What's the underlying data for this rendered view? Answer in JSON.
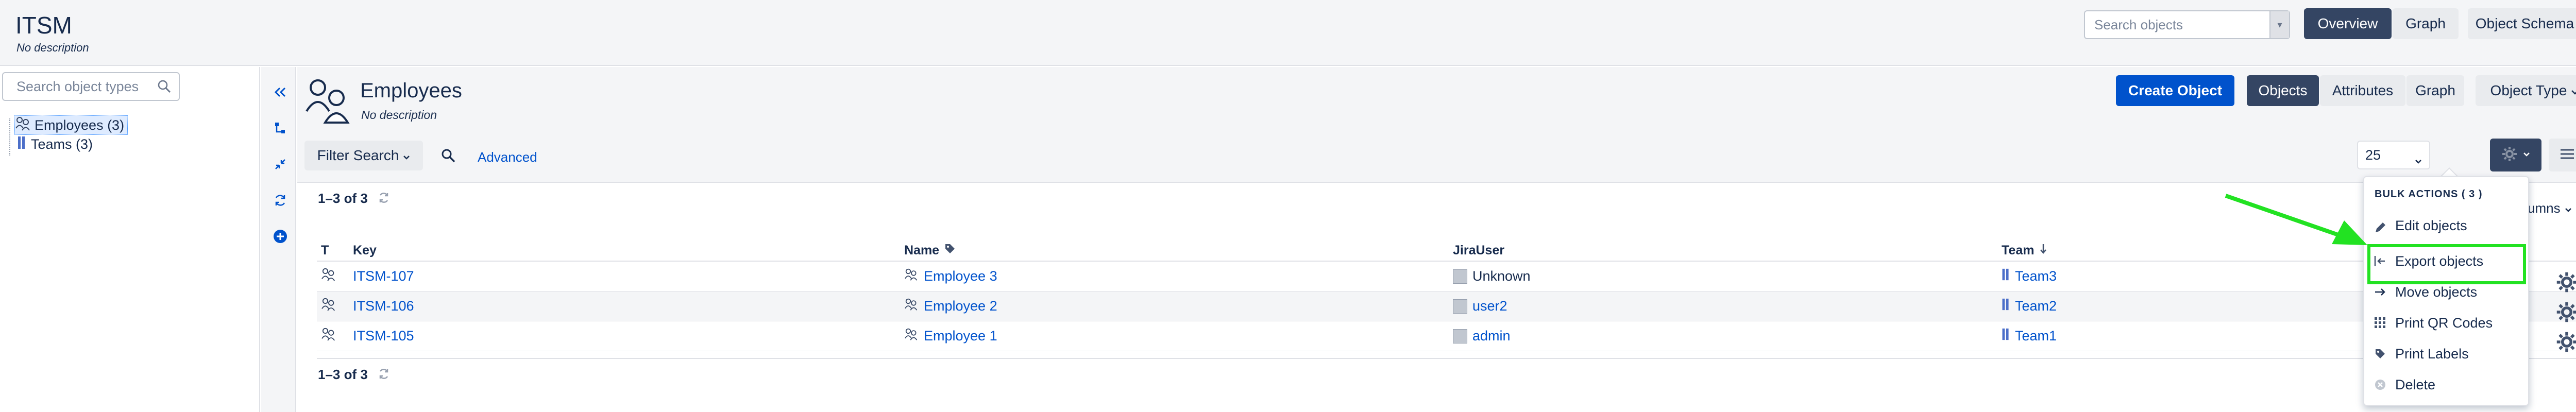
{
  "header": {
    "title": "ITSM",
    "description": "No description",
    "search_placeholder": "Search objects",
    "overview_label": "Overview",
    "graph_label": "Graph",
    "schema_label": "Object Schema"
  },
  "sidebar": {
    "search_placeholder": "Search object types",
    "items": [
      {
        "label": "Employees (3)"
      },
      {
        "label": "Teams (3)"
      }
    ]
  },
  "page": {
    "title": "Employees",
    "description": "No description",
    "create_label": "Create Object",
    "tabs": [
      "Objects",
      "Attributes",
      "Graph"
    ],
    "object_type_label": "Object Type"
  },
  "filter": {
    "filter_label": "Filter Search",
    "advanced_label": "Advanced",
    "per_page": "25"
  },
  "results": {
    "count_label": "1–3 of 3",
    "columns_label": "Columns"
  },
  "table": {
    "headers": [
      "T",
      "Key",
      "Name",
      "JiraUser",
      "Team"
    ],
    "rows": [
      {
        "key": "ITSM-107",
        "name": "Employee 3",
        "jira": "Unknown",
        "team": "Team3"
      },
      {
        "key": "ITSM-106",
        "name": "Employee 2",
        "jira": "user2",
        "team": "Team2"
      },
      {
        "key": "ITSM-105",
        "name": "Employee 1",
        "jira": "admin",
        "team": "Team1"
      }
    ]
  },
  "bulk": {
    "header": "BULK ACTIONS ( 3 )",
    "items": [
      "Edit objects",
      "Export objects",
      "Move objects",
      "Print QR Codes",
      "Print Labels",
      "Delete"
    ]
  },
  "colors": {
    "brand_blue": "#0052cc",
    "dark_button": "#344563",
    "highlight": "#22e222"
  }
}
